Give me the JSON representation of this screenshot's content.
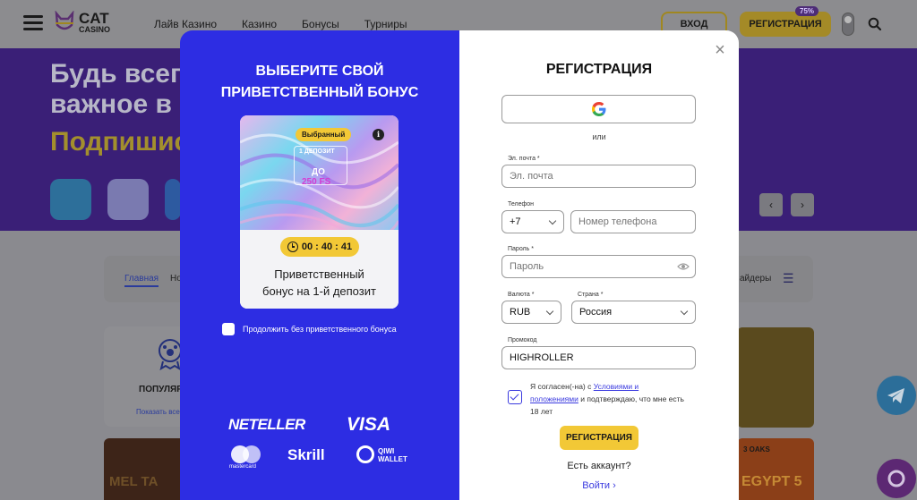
{
  "header": {
    "logo_line1": "CAT",
    "logo_line2": "CASINO",
    "nav": [
      "Лайв Казино",
      "Казино",
      "Бонусы",
      "Турниры"
    ],
    "login_label": "ВХОД",
    "register_label": "РЕГИСТРАЦИЯ",
    "register_badge": "75%"
  },
  "hero": {
    "line1": "Будь всегда",
    "line2": "важное в",
    "line3": "Подпишись"
  },
  "background_tabs": {
    "main": "Главная",
    "next": "Но",
    "providers": "айдеры"
  },
  "background_cards": {
    "popular_title": "ПОПУЛЯРНЫЕ",
    "popular_link": "Показать все",
    "game_left": "MEL TA",
    "game_right_brand": "3 OAKS",
    "game_right_title": "EGYPT 5"
  },
  "bonus_panel": {
    "title": "ВЫБЕРИТЕ СВОЙ ПРИВЕТСТВЕННЫЙ БОНУС",
    "card": {
      "selected_chip": "Выбранный",
      "deposit_label": "1 ДЕПОЗИТ",
      "upto": "ДО",
      "amount": "250 FS",
      "timer": "00 : 40 : 41",
      "name": "Приветственный бонус на 1-й депозит"
    },
    "skip_label": "Продолжить без приветственного бонуса",
    "payments": {
      "neteller": "NETELLER",
      "visa": "VISA",
      "mastercard": "mastercard",
      "skrill": "Skrill",
      "qiwi": "QIWI WALLET"
    }
  },
  "registration": {
    "title": "РЕГИСТРАЦИЯ",
    "or": "или",
    "email_label": "Эл. почта *",
    "email_placeholder": "Эл. почта",
    "phone_label": "Телефон",
    "phone_code": "+7",
    "phone_placeholder": "Номер телефона",
    "password_label": "Пароль *",
    "password_placeholder": "Пароль",
    "currency_label": "Валюта *",
    "currency_value": "RUB",
    "country_label": "Страна *",
    "country_value": "Россия",
    "promo_label": "Промокод",
    "promo_value": "HIGHROLLER",
    "agree_prefix": "Я согласен(-на) с",
    "agree_link": "Условиями и положениями",
    "agree_suffix": "и подтверждаю, что мне есть 18 лет",
    "submit_label": "РЕГИСТРАЦИЯ",
    "have_account": "Есть аккаунт?",
    "login_link": "Войти"
  },
  "colors": {
    "bonus_bg": "#2d2de3",
    "accent_yellow": "#f2c836",
    "link_blue": "#3a3adf"
  }
}
